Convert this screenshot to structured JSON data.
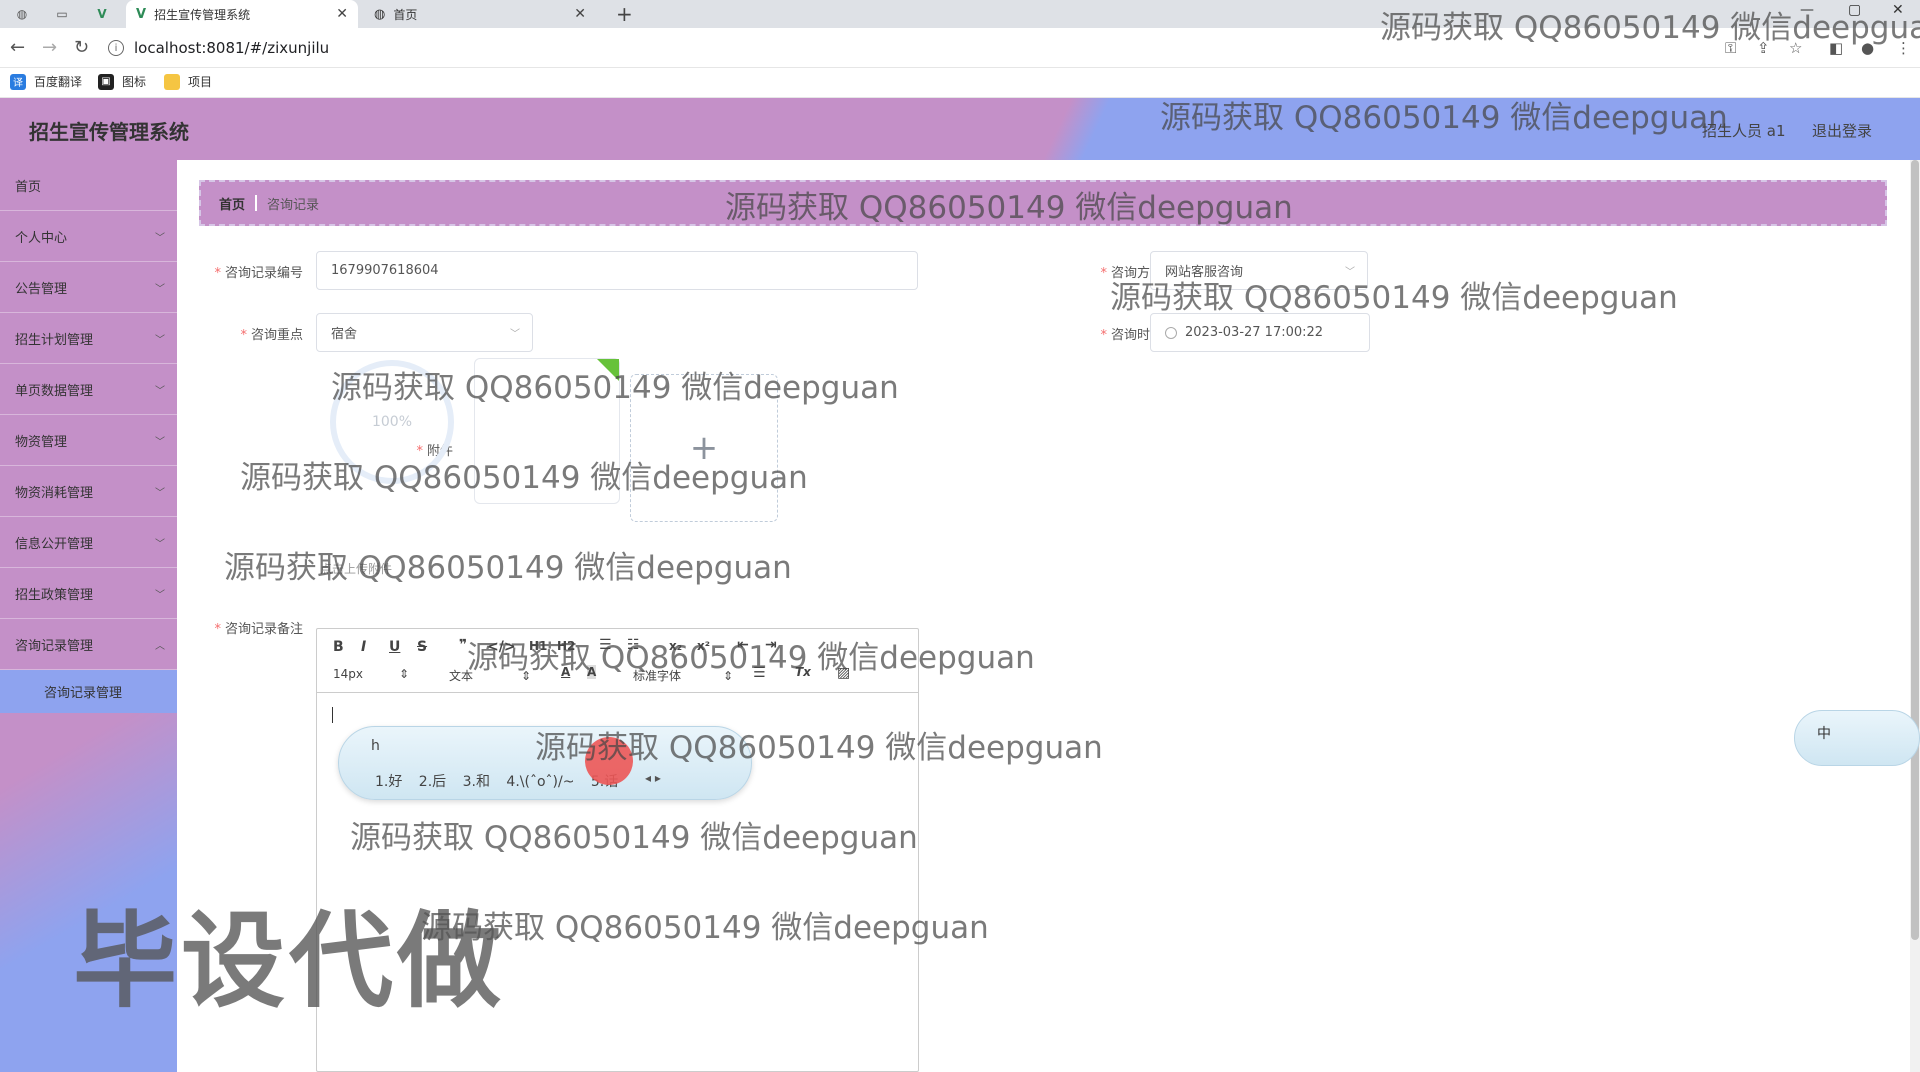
{
  "browser": {
    "tabs": [
      {
        "title": "招生宣传管理系统",
        "active": true
      },
      {
        "title": "首页",
        "active": false
      }
    ],
    "url": "localhost:8081/#/zixunjilu",
    "bookmarks": [
      "百度翻译",
      "图标",
      "项目"
    ]
  },
  "header": {
    "title": "招生宣传管理系统",
    "user": "招生人员 a1",
    "logout": "退出登录"
  },
  "sidebar": {
    "items": [
      {
        "label": "首页"
      },
      {
        "label": "个人中心"
      },
      {
        "label": "公告管理"
      },
      {
        "label": "招生计划管理"
      },
      {
        "label": "单页数据管理"
      },
      {
        "label": "物资管理"
      },
      {
        "label": "物资消耗管理"
      },
      {
        "label": "信息公开管理"
      },
      {
        "label": "招生政策管理"
      },
      {
        "label": "咨询记录管理"
      }
    ],
    "submenu": {
      "label": "咨询记录管理"
    }
  },
  "breadcrumb": {
    "home": "首页",
    "current": "咨询记录"
  },
  "form": {
    "record_no_label": "咨询记录编号",
    "record_no_value": "1679907618604",
    "method_label": "咨询方式",
    "method_value": "网站客服咨询",
    "focus_label": "咨询重点",
    "focus_value": "宿舍",
    "time_label": "咨询时间",
    "time_value": "2023-03-27 17:00:22",
    "attachment_label": "附件",
    "upload_progress": "100%",
    "upload_tip": "点击上传附件",
    "notes_label": "咨询记录备注"
  },
  "editor": {
    "font_size": "14px",
    "paragraph": "文本",
    "font_family": "标准字体"
  },
  "ime": {
    "input": "h",
    "candidates": "1.好 2.后 3.和 4.\\(ˆoˆ)/~ 5.话",
    "tray_label": "中"
  },
  "watermark": {
    "text": "源码获取 QQ86050149 微信deepguan",
    "big_text": "毕设代做"
  },
  "colors": {
    "purple": "#c490c8",
    "blue": "#8ea3ef",
    "required": "#f56c6c"
  }
}
